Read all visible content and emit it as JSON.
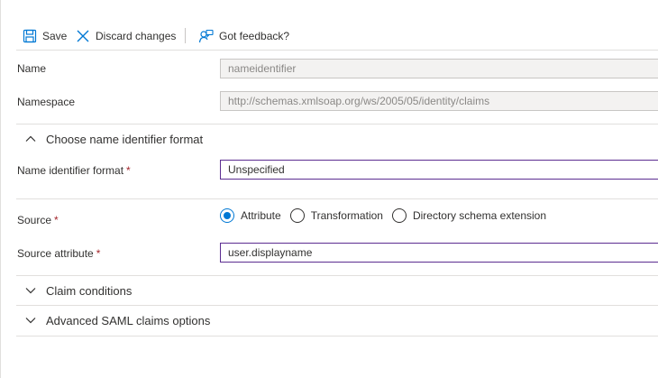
{
  "toolbar": {
    "save_label": "Save",
    "discard_label": "Discard changes",
    "feedback_label": "Got feedback?"
  },
  "fields": {
    "name": {
      "label": "Name",
      "value": "nameidentifier"
    },
    "namespace": {
      "label": "Namespace",
      "value": "http://schemas.xmlsoap.org/ws/2005/05/identity/claims"
    },
    "name_identifier_format": {
      "label": "Name identifier format",
      "required_mark": "*",
      "value": "Unspecified"
    },
    "source": {
      "label": "Source",
      "required_mark": "*",
      "options": [
        "Attribute",
        "Transformation",
        "Directory schema extension"
      ],
      "selected": "Attribute"
    },
    "source_attribute": {
      "label": "Source attribute",
      "required_mark": "*",
      "value": "user.displayname"
    }
  },
  "sections": {
    "name_identifier": {
      "label": "Choose name identifier format",
      "expanded": true
    },
    "claim_conditions": {
      "label": "Claim conditions",
      "expanded": false
    },
    "advanced_saml": {
      "label": "Advanced SAML claims options",
      "expanded": false
    }
  },
  "colors": {
    "accent_blue": "#0078d4",
    "active_input_border": "#5c2d91",
    "required_red": "#a4262c",
    "divider": "#e1dfdd"
  },
  "icons": {
    "save": "save-icon",
    "discard": "close-icon",
    "feedback": "feedback-icon",
    "expanded": "chevron-up-icon",
    "collapsed": "chevron-down-icon"
  }
}
